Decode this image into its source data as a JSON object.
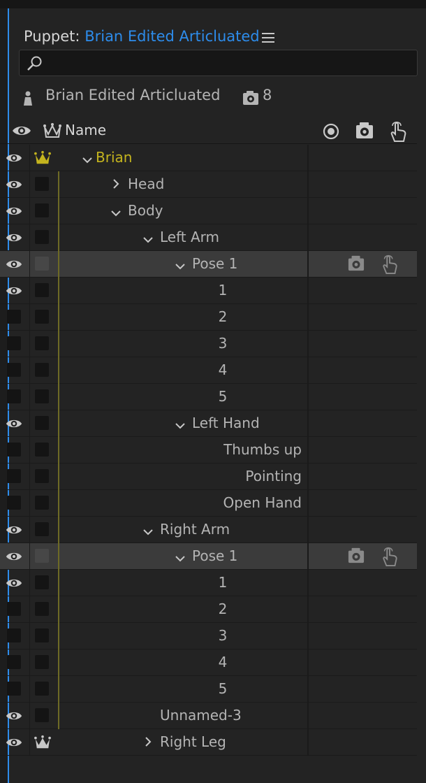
{
  "panel": {
    "title_prefix": "Puppet:",
    "puppet_name": "Brian Edited Articluated"
  },
  "search": {
    "value": "",
    "icon": "search-icon"
  },
  "puppet_info": {
    "name": "Brian Edited Articluated",
    "count": "8"
  },
  "header": {
    "name_label": "Name"
  },
  "colors": {
    "accent": "#2d8ceb",
    "root_label": "#c4b41e",
    "guide_line": "#6e6a26",
    "panel_bg": "#232323"
  },
  "rows": [
    {
      "label": "Brian",
      "eye": true,
      "crown": "gold",
      "chevron": "down",
      "root": true
    },
    {
      "label": "Head",
      "eye": true,
      "crown": "",
      "chevron": "right"
    },
    {
      "label": "Body",
      "eye": true,
      "crown": "",
      "chevron": "down"
    },
    {
      "label": "Left Arm",
      "eye": true,
      "crown": "",
      "chevron": "down"
    },
    {
      "label": "Pose 1",
      "eye": true,
      "crown": "",
      "chevron": "down",
      "selected": true,
      "icons": true
    },
    {
      "label": "1",
      "eye": true,
      "crown": ""
    },
    {
      "label": "2",
      "eye": false,
      "crown": ""
    },
    {
      "label": "3",
      "eye": false,
      "crown": ""
    },
    {
      "label": "4",
      "eye": false,
      "crown": ""
    },
    {
      "label": "5",
      "eye": false,
      "crown": ""
    },
    {
      "label": "Left Hand",
      "eye": true,
      "crown": "",
      "chevron": "down"
    },
    {
      "label": "Thumbs up",
      "eye": false,
      "crown": ""
    },
    {
      "label": "Pointing",
      "eye": false,
      "crown": ""
    },
    {
      "label": "Open Hand",
      "eye": false,
      "crown": ""
    },
    {
      "label": "Right Arm",
      "eye": true,
      "crown": "",
      "chevron": "down"
    },
    {
      "label": "Pose 1",
      "eye": true,
      "crown": "",
      "chevron": "down",
      "selected": true,
      "icons": true
    },
    {
      "label": "1",
      "eye": true,
      "crown": ""
    },
    {
      "label": "2",
      "eye": false,
      "crown": ""
    },
    {
      "label": "3",
      "eye": false,
      "crown": ""
    },
    {
      "label": "4",
      "eye": false,
      "crown": ""
    },
    {
      "label": "5",
      "eye": false,
      "crown": ""
    },
    {
      "label": "Unnamed-3",
      "eye": true,
      "crown": ""
    },
    {
      "label": "Right Leg",
      "eye": true,
      "crown": "white",
      "chevron": "right"
    }
  ]
}
